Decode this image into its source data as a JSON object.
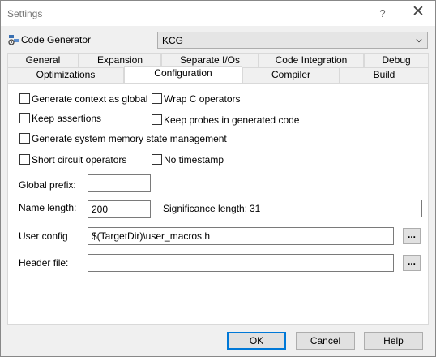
{
  "window": {
    "title": "Settings",
    "help_glyph": "?",
    "close_glyph": "✕"
  },
  "code_generator": {
    "label": "Code Generator",
    "selected": "KCG",
    "icon": "code-generator-icon"
  },
  "tabs_row1": [
    "General",
    "Expansion",
    "Separate I/Os",
    "Code Integration",
    "Debug"
  ],
  "tabs_row2": [
    "Optimizations",
    "Configuration",
    "Compiler",
    "Build"
  ],
  "active_tab": "Configuration",
  "options": {
    "gen_context_global": {
      "label": "Generate context as global",
      "checked": false
    },
    "wrap_c_operators": {
      "label": "Wrap C operators",
      "checked": false
    },
    "keep_assertions": {
      "label": "Keep assertions",
      "checked": false
    },
    "keep_probes": {
      "label": "Keep probes in generated code",
      "checked": false
    },
    "gen_system_memory": {
      "label": "Generate system memory state management",
      "checked": false
    },
    "short_circuit": {
      "label": "Short circuit operators",
      "checked": false
    },
    "no_timestamp": {
      "label": "No timestamp",
      "checked": false
    }
  },
  "fields": {
    "global_prefix": {
      "label": "Global prefix:",
      "value": ""
    },
    "name_length": {
      "label": "Name length:",
      "value": "200"
    },
    "significance_length": {
      "label": "Significance length:",
      "value": "31"
    },
    "user_config": {
      "label": "User config",
      "value": "$(TargetDir)\\user_macros.h",
      "browse": "..."
    },
    "header_file": {
      "label": "Header file:",
      "value": "",
      "browse": "..."
    }
  },
  "buttons": {
    "ok": "OK",
    "cancel": "Cancel",
    "help": "Help"
  },
  "colors": {
    "accent": "#0078d7",
    "panel": "#ffffff",
    "chrome": "#f0f0f0"
  }
}
